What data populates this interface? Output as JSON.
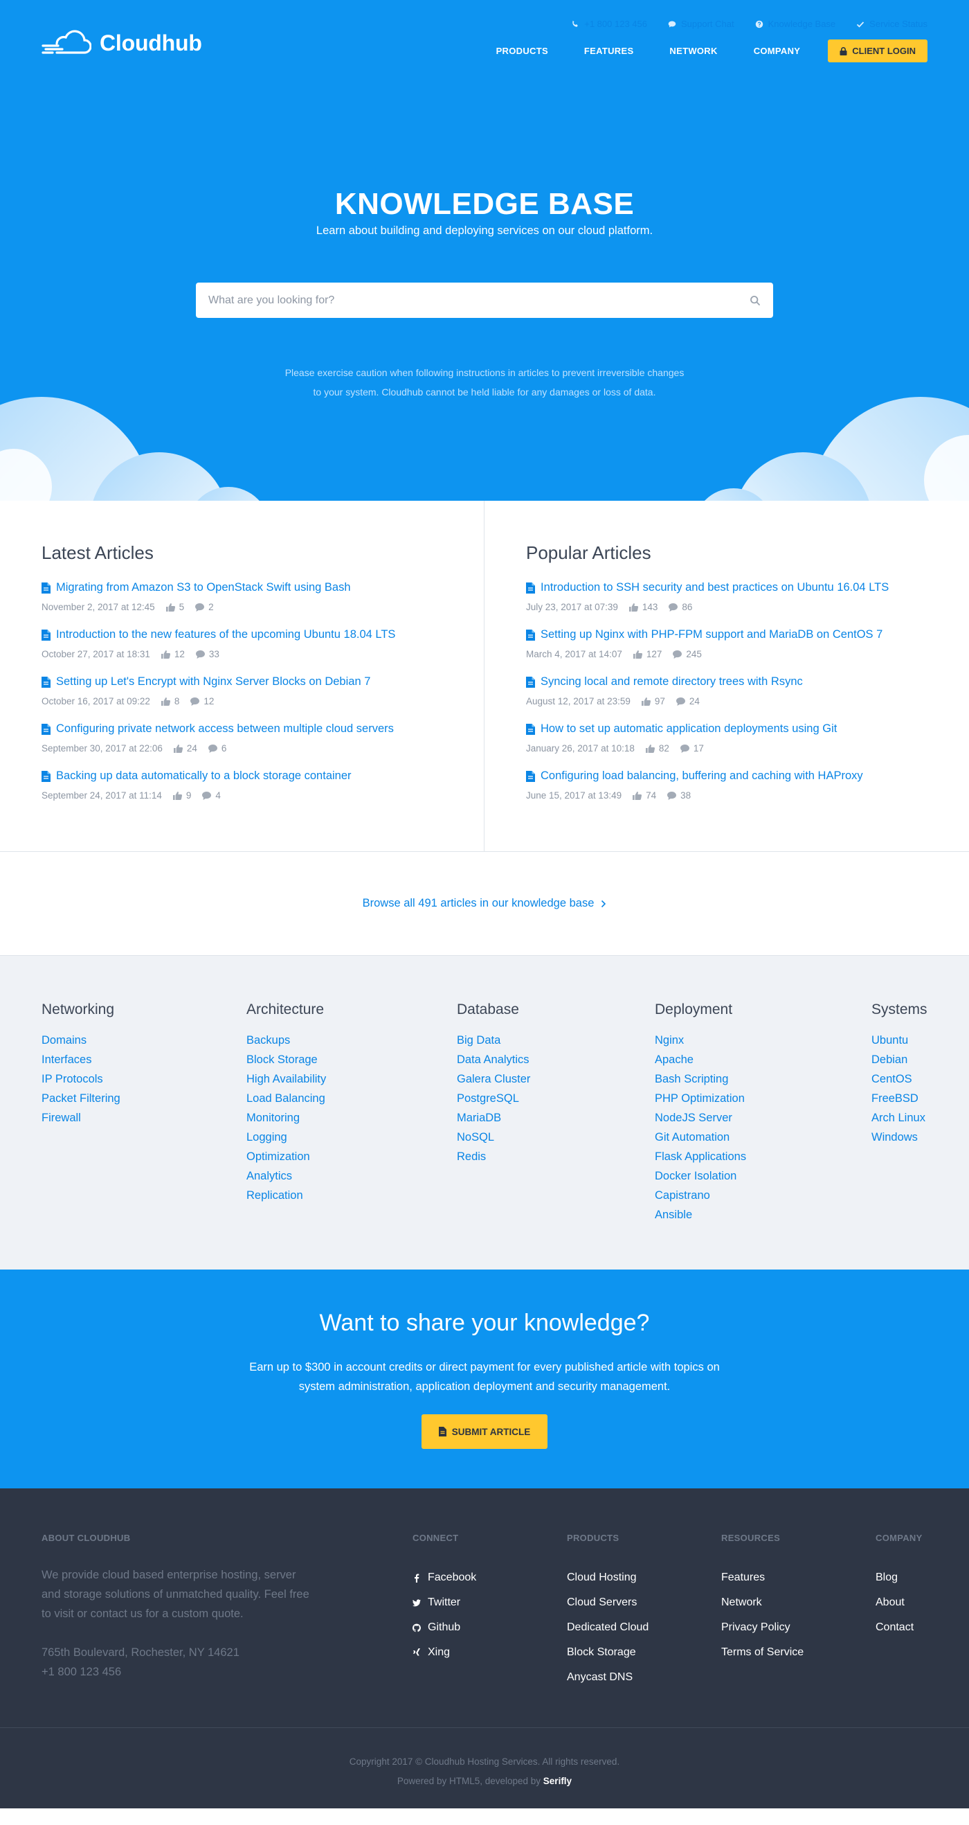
{
  "brand": {
    "name": "Cloudhub"
  },
  "topbar": [
    {
      "icon": "phone-icon",
      "label": "+1 800 123 456"
    },
    {
      "icon": "chat-icon",
      "label": "Support Chat"
    },
    {
      "icon": "help-icon",
      "label": "Knowledge Base"
    },
    {
      "icon": "check-icon",
      "label": "Service Status"
    }
  ],
  "nav": {
    "items": [
      "PRODUCTS",
      "FEATURES",
      "NETWORK",
      "COMPANY"
    ],
    "login_label": "CLIENT LOGIN"
  },
  "hero": {
    "title": "KNOWLEDGE BASE",
    "subtitle": "Learn about building and deploying services on our cloud platform.",
    "search_placeholder": "What are you looking for?",
    "caution_line1": "Please exercise caution when following instructions in articles to prevent irreversible changes",
    "caution_line2": "to your system. Cloudhub cannot be held liable for any damages or loss of data."
  },
  "latest": {
    "title": "Latest Articles",
    "items": [
      {
        "title": "Migrating from Amazon S3 to OpenStack Swift using Bash",
        "date": "November 2, 2017 at 12:45",
        "likes": "5",
        "comments": "2"
      },
      {
        "title": "Introduction to the new features of the upcoming Ubuntu 18.04 LTS",
        "date": "October 27, 2017 at 18:31",
        "likes": "12",
        "comments": "33"
      },
      {
        "title": "Setting up Let's Encrypt with Nginx Server Blocks on Debian 7",
        "date": "October 16, 2017 at 09:22",
        "likes": "8",
        "comments": "12"
      },
      {
        "title": "Configuring private network access between multiple cloud servers",
        "date": "September 30, 2017 at 22:06",
        "likes": "24",
        "comments": "6"
      },
      {
        "title": "Backing up data automatically to a block storage container",
        "date": "September 24, 2017 at 11:14",
        "likes": "9",
        "comments": "4"
      }
    ]
  },
  "popular": {
    "title": "Popular Articles",
    "items": [
      {
        "title": "Introduction to SSH security and best practices on Ubuntu 16.04 LTS",
        "date": "July 23, 2017 at 07:39",
        "likes": "143",
        "comments": "86"
      },
      {
        "title": "Setting up Nginx with PHP-FPM support and MariaDB on CentOS 7",
        "date": "March 4, 2017 at 14:07",
        "likes": "127",
        "comments": "245"
      },
      {
        "title": "Syncing local and remote directory trees with Rsync",
        "date": "August 12, 2017 at 23:59",
        "likes": "97",
        "comments": "24"
      },
      {
        "title": "How to set up automatic application deployments using Git",
        "date": "January 26, 2017 at 10:18",
        "likes": "82",
        "comments": "17"
      },
      {
        "title": "Configuring load balancing, buffering and caching with HAProxy",
        "date": "June 15, 2017 at 13:49",
        "likes": "74",
        "comments": "38"
      }
    ]
  },
  "browse": {
    "label": "Browse all 491 articles in our knowledge base"
  },
  "categories": [
    {
      "title": "Networking",
      "links": [
        "Domains",
        "Interfaces",
        "IP Protocols",
        "Packet Filtering",
        "Firewall"
      ]
    },
    {
      "title": "Architecture",
      "links": [
        "Backups",
        "Block Storage",
        "High Availability",
        "Load Balancing",
        "Monitoring",
        "Logging",
        "Optimization",
        "Analytics",
        "Replication"
      ]
    },
    {
      "title": "Database",
      "links": [
        "Big Data",
        "Data Analytics",
        "Galera Cluster",
        "PostgreSQL",
        "MariaDB",
        "NoSQL",
        "Redis"
      ]
    },
    {
      "title": "Deployment",
      "links": [
        "Nginx",
        "Apache",
        "Bash Scripting",
        "PHP Optimization",
        "NodeJS Server",
        "Git Automation",
        "Flask Applications",
        "Docker Isolation",
        "Capistrano",
        "Ansible"
      ]
    },
    {
      "title": "Systems",
      "links": [
        "Ubuntu",
        "Debian",
        "CentOS",
        "FreeBSD",
        "Arch Linux",
        "Windows"
      ]
    }
  ],
  "cta": {
    "title": "Want to share your knowledge?",
    "text": "Earn up to $300 in account credits or direct payment for every published article with topics on system administration, application deployment and security management.",
    "button": "SUBMIT ARTICLE"
  },
  "footer": {
    "about": {
      "title": "ABOUT CLOUDHUB",
      "text": "We provide cloud based enterprise hosting, server and storage solutions of unmatched quality. Feel free to visit or contact us for a custom quote.",
      "address": "765th Boulevard, Rochester, NY 14621",
      "phone": "+1 800 123 456"
    },
    "connect": {
      "title": "CONNECT",
      "links": [
        {
          "icon": "facebook-icon",
          "label": "Facebook"
        },
        {
          "icon": "twitter-icon",
          "label": "Twitter"
        },
        {
          "icon": "github-icon",
          "label": "Github"
        },
        {
          "icon": "xing-icon",
          "label": "Xing"
        }
      ]
    },
    "products": {
      "title": "PRODUCTS",
      "links": [
        "Cloud Hosting",
        "Cloud Servers",
        "Dedicated Cloud",
        "Block Storage",
        "Anycast DNS"
      ]
    },
    "resources": {
      "title": "RESOURCES",
      "links": [
        "Features",
        "Network",
        "Privacy Policy",
        "Terms of Service"
      ]
    },
    "company": {
      "title": "COMPANY",
      "links": [
        "Blog",
        "About",
        "Contact"
      ]
    }
  },
  "copyright": {
    "line1": "Copyright 2017 © Cloudhub Hosting Services. All rights reserved.",
    "line2_prefix": "Powered by HTML5, developed by",
    "line2_brand": "Serifly"
  },
  "colors": {
    "primary": "#0d94f0",
    "accent": "#ffc82e",
    "link": "#0a85e5",
    "footer": "#2e3645"
  }
}
